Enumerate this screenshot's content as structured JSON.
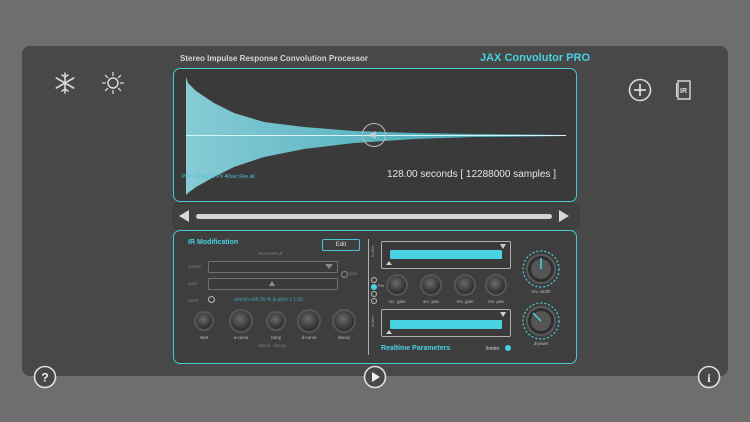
{
  "app": {
    "subtitle": "Stereo Impulse Response Convolution Processor",
    "title": "JAX Convolutor PRO"
  },
  "colors": {
    "accent": "#49d2e2",
    "panel": "#484848",
    "background": "#6e6e6e"
  },
  "top_left_icons": [
    "snowflake-icon",
    "sun-icon"
  ],
  "top_right_icons": [
    "add-circle-icon",
    "ir-document-icon"
  ],
  "waveform": {
    "ir_name": "P09 - Universe PX 40sec Rev all",
    "duration_text": "128.00 seconds [ 12288000 samples ]",
    "speaker_icon": "speaker-icon"
  },
  "ir_modification": {
    "title": "IR Modification",
    "edit_label": "Edit",
    "resample_label": "RESAMPLE",
    "stretch_label": "stretch",
    "pitch_label": "pitch",
    "lock_label": "lock",
    "reset_label": "reset",
    "status_text": "stretch x68.00 % & pitch x 1.00",
    "knobs": [
      "start",
      "a-curve",
      "ramp",
      "d-curve",
      "decay"
    ],
    "knobs_group_label": "attack - decay"
  },
  "realtime": {
    "title": "Realtime Parameters",
    "limiter_label": "limiter",
    "hi_filter_label": "hi-filter",
    "lo_filter_label": "lo-filter",
    "knobs": [
      "src. gain",
      "src. pan",
      "rev. gain",
      "rev. pan"
    ],
    "big_knobs": [
      "rev. width",
      "dry/wet"
    ],
    "pre_label": "Pre"
  },
  "bottom_icons": [
    "help-icon",
    "play-icon",
    "info-icon"
  ]
}
